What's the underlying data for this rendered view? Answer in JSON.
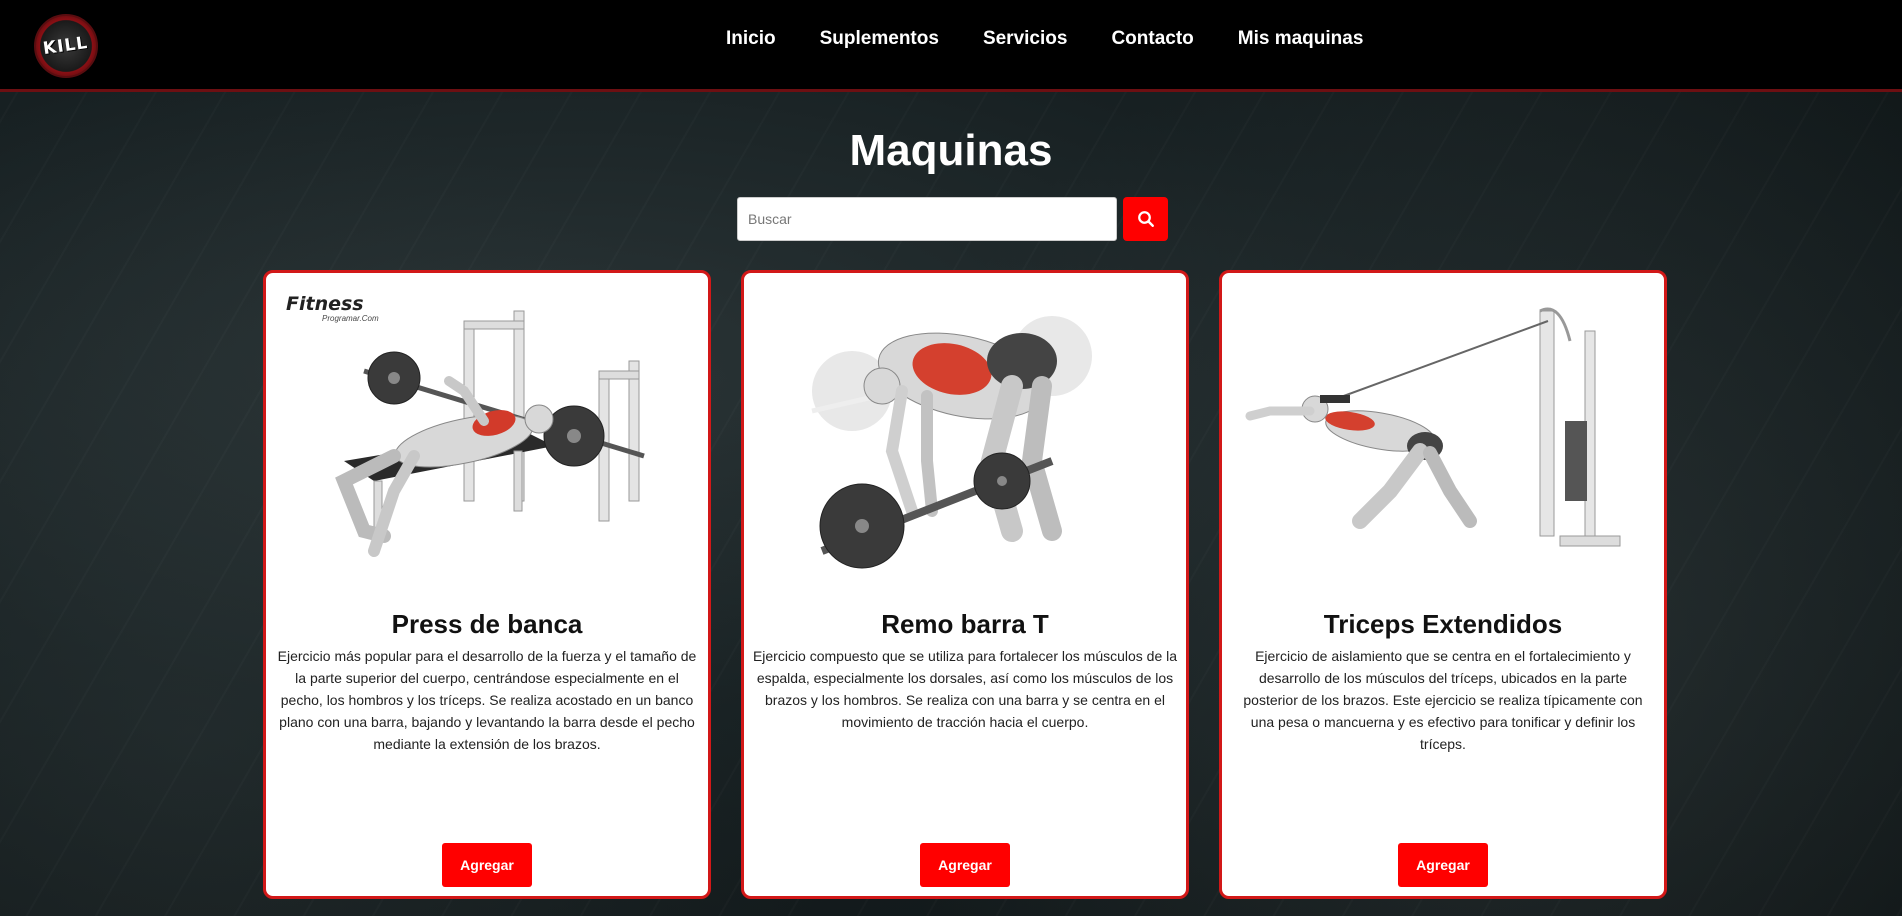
{
  "navbar": {
    "logo_text": "KILL",
    "links": [
      "Inicio",
      "Suplementos",
      "Servicios",
      "Contacto",
      "Mis maquinas"
    ]
  },
  "page": {
    "title": "Maquinas"
  },
  "search": {
    "placeholder": "Buscar",
    "value": ""
  },
  "cards": [
    {
      "title": "Press de banca",
      "description": "Ejercicio más popular para el desarrollo de la fuerza y el tamaño de la parte superior del cuerpo, centrándose especialmente en el pecho, los hombros y los tríceps. Se realiza acostado en un banco plano con una barra, bajando y levantando la barra desde el pecho mediante la extensión de los brazos.",
      "button_label": "Agregar",
      "brand": "Fitness",
      "brand_sub": "Programar.Com"
    },
    {
      "title": "Remo barra T",
      "description": "Ejercicio compuesto que se utiliza para fortalecer los músculos de la espalda, especialmente los dorsales, así como los músculos de los brazos y los hombros. Se realiza con una barra y se centra en el movimiento de tracción hacia el cuerpo.",
      "button_label": "Agregar"
    },
    {
      "title": "Triceps Extendidos",
      "description": "Ejercicio de aislamiento que se centra en el fortalecimiento y desarrollo de los músculos del tríceps, ubicados en la parte posterior de los brazos. Este ejercicio se realiza típicamente con una pesa o mancuerna y es efectivo para tonificar y definir los tríceps.",
      "button_label": "Agregar"
    }
  ],
  "colors": {
    "accent": "#ff0000",
    "card_border": "#d21818",
    "navbar_bg": "#000000"
  },
  "icons": {
    "search_button": "search-icon"
  }
}
